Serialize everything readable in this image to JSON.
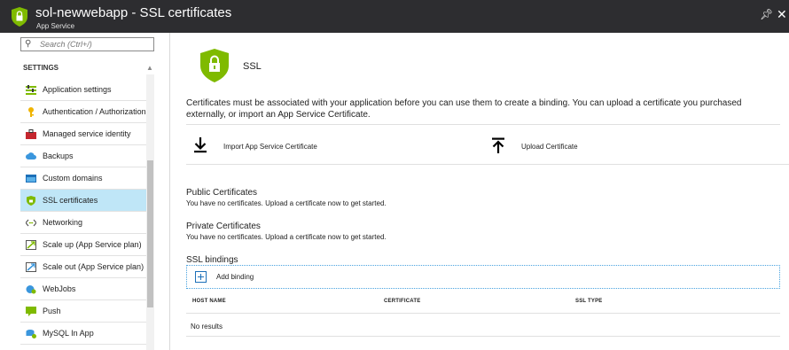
{
  "header": {
    "title": "sol-newwebapp - SSL certificates",
    "subtitle": "App Service",
    "pin_icon": "pin-icon",
    "close_icon": "close-icon"
  },
  "sidebar": {
    "search_placeholder": "Search (Ctrl+/)",
    "section_title": "SETTINGS",
    "items": [
      {
        "label": "Application settings",
        "icon": "application-settings-icon",
        "active": false
      },
      {
        "label": "Authentication / Authorization",
        "icon": "key-icon",
        "active": false
      },
      {
        "label": "Managed service identity",
        "icon": "toolbox-icon",
        "active": false
      },
      {
        "label": "Backups",
        "icon": "cloud-backup-icon",
        "active": false
      },
      {
        "label": "Custom domains",
        "icon": "domain-icon",
        "active": false
      },
      {
        "label": "SSL certificates",
        "icon": "shield-icon",
        "active": true
      },
      {
        "label": "Networking",
        "icon": "networking-icon",
        "active": false
      },
      {
        "label": "Scale up (App Service plan)",
        "icon": "scale-up-icon",
        "active": false
      },
      {
        "label": "Scale out (App Service plan)",
        "icon": "scale-out-icon",
        "active": false
      },
      {
        "label": "WebJobs",
        "icon": "webjobs-icon",
        "active": false
      },
      {
        "label": "Push",
        "icon": "push-icon",
        "active": false
      },
      {
        "label": "MySQL In App",
        "icon": "mysql-icon",
        "active": false
      }
    ]
  },
  "main": {
    "heading": "SSL",
    "description": "Certificates must be associated with your application before you can use them to create a binding. You can upload a certificate you purchased externally, or import an App Service Certificate.",
    "commands": {
      "import_label": "Import App Service Certificate",
      "upload_label": "Upload Certificate"
    },
    "public": {
      "title": "Public Certificates",
      "text": "You have no certificates. Upload a certificate now to get started."
    },
    "private": {
      "title": "Private Certificates",
      "text": "You have no certificates. Upload a certificate now to get started."
    },
    "bindings": {
      "title": "SSL bindings",
      "add_label": "Add binding",
      "columns": [
        "HOST NAME",
        "CERTIFICATE",
        "SSL TYPE"
      ],
      "empty_text": "No results"
    }
  },
  "colors": {
    "titlebar": "#2d2d30",
    "active_item": "#bfe6f7",
    "shield_green": "#7fba00",
    "accent_blue": "#1c6fb8"
  }
}
